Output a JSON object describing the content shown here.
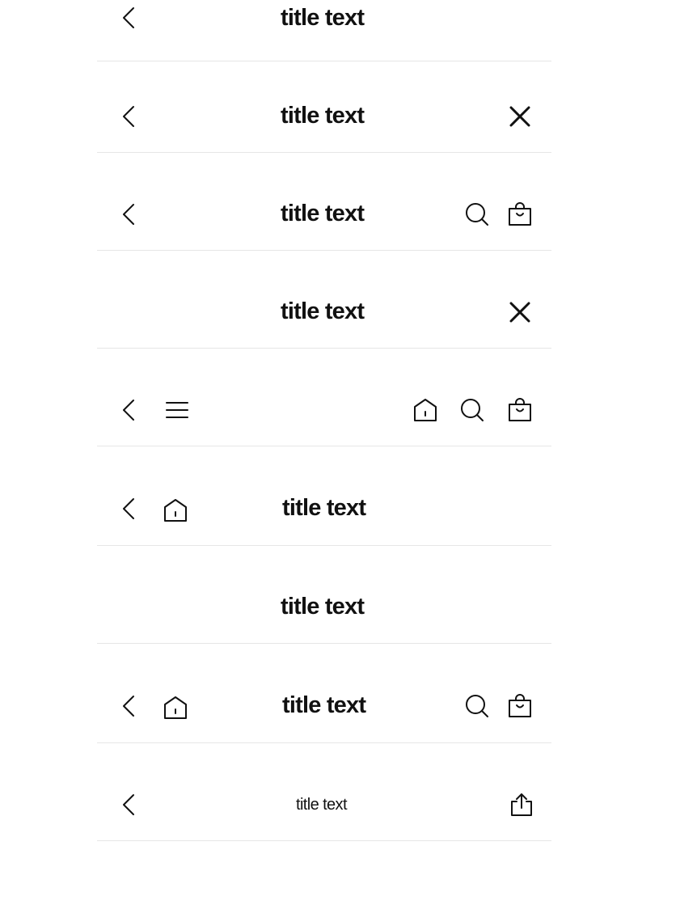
{
  "bars": [
    {
      "title": "title text"
    },
    {
      "title": "title text"
    },
    {
      "title": "title text"
    },
    {
      "title": "title text"
    },
    {
      "title": ""
    },
    {
      "title": "title text"
    },
    {
      "title": "title text"
    },
    {
      "title": "title text"
    },
    {
      "title": "title text"
    }
  ],
  "icons": {
    "back": "chevron-left-icon",
    "close": "close-icon",
    "search": "search-icon",
    "bag": "shopping-bag-icon",
    "menu": "hamburger-menu-icon",
    "home": "home-icon",
    "share": "share-icon"
  },
  "colors": {
    "text": "#111111",
    "divider": "#e6e6e6",
    "background": "#ffffff"
  }
}
